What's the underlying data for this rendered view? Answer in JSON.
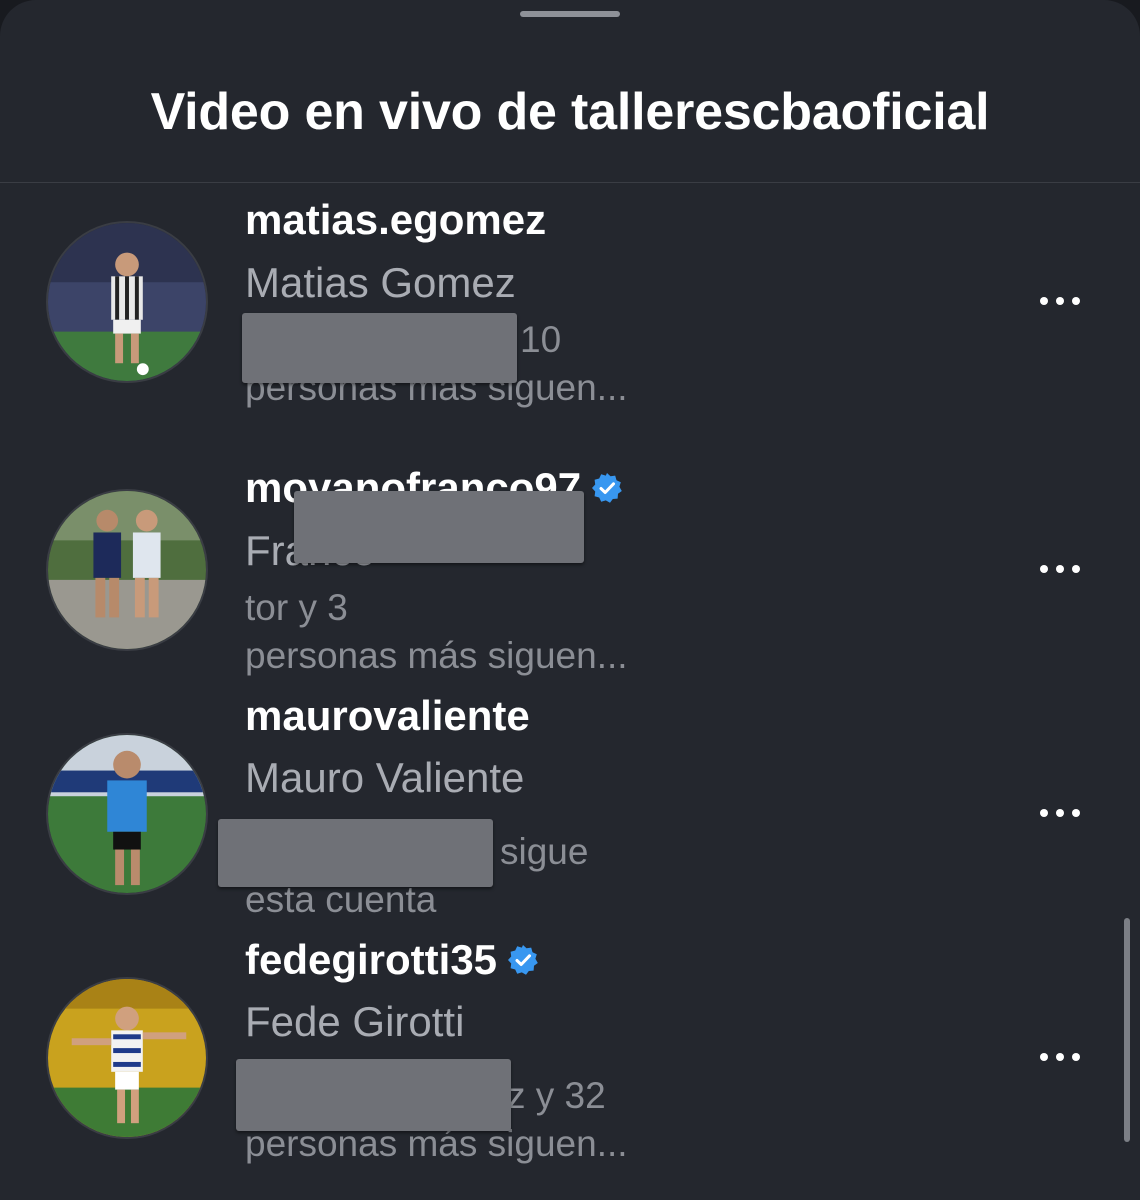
{
  "header": {
    "title": "Video en vivo de tallerescbaoficial"
  },
  "viewers": [
    {
      "username": "matias.egomez",
      "verified": false,
      "full_name": "Matias Gomez",
      "social_line1": "10",
      "social_line2": "personas más siguen..."
    },
    {
      "username": "moyanofranco97",
      "verified": true,
      "full_name": "Franco",
      "social_line1": "tor y 3",
      "social_line2": "personas más siguen..."
    },
    {
      "username": "maurovaliente",
      "verified": false,
      "full_name": "Mauro Valiente",
      "social_line1": "sigue",
      "social_line2": "esta cuenta"
    },
    {
      "username": "fedegirotti35",
      "verified": true,
      "full_name": "Fede Girotti",
      "social_line1": "z y 32",
      "social_line2": "personas más siguen..."
    }
  ],
  "icons": {
    "verified": "verified-badge-icon",
    "more": "more-options-icon"
  },
  "colors": {
    "background": "#24272e",
    "verified_blue": "#3897f0",
    "redaction": "#6f7177"
  }
}
